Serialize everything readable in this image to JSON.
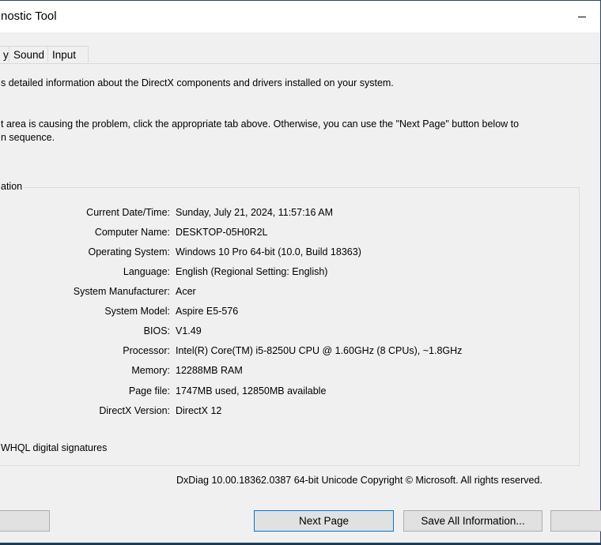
{
  "window": {
    "title": "nostic Tool",
    "minimize_label": "Minimize"
  },
  "tabs": [
    {
      "label": "y"
    },
    {
      "label": "Sound"
    },
    {
      "label": "Input"
    }
  ],
  "intro": {
    "line1": "s detailed information about the DirectX components and drivers installed on your system.",
    "line2": "t area is causing the problem, click the appropriate tab above.  Otherwise, you can use the \"Next Page\" button below to",
    "line3": "n sequence."
  },
  "system_info": {
    "group_label": "ation",
    "rows": [
      {
        "label": "Current Date/Time:",
        "value": "Sunday, July 21, 2024, 11:57:16 AM"
      },
      {
        "label": "Computer Name:",
        "value": "DESKTOP-05H0R2L"
      },
      {
        "label": "Operating System:",
        "value": "Windows 10 Pro 64-bit (10.0, Build 18363)"
      },
      {
        "label": "Language:",
        "value": "English (Regional Setting: English)"
      },
      {
        "label": "System Manufacturer:",
        "value": "Acer"
      },
      {
        "label": "System Model:",
        "value": "Aspire E5-576"
      },
      {
        "label": "BIOS:",
        "value": "V1.49"
      },
      {
        "label": "Processor:",
        "value": "Intel(R) Core(TM) i5-8250U CPU @ 1.60GHz (8 CPUs), ~1.8GHz"
      },
      {
        "label": "Memory:",
        "value": "12288MB RAM"
      },
      {
        "label": "Page file:",
        "value": "1747MB used, 12850MB available"
      },
      {
        "label": "DirectX Version:",
        "value": "DirectX 12"
      }
    ],
    "whql_label": "WHQL digital signatures"
  },
  "footer": {
    "version_text": "DxDiag 10.00.18362.0387 64-bit Unicode  Copyright © Microsoft. All rights reserved."
  },
  "buttons": {
    "next_page": "Next Page",
    "save_all": "Save All Information..."
  }
}
